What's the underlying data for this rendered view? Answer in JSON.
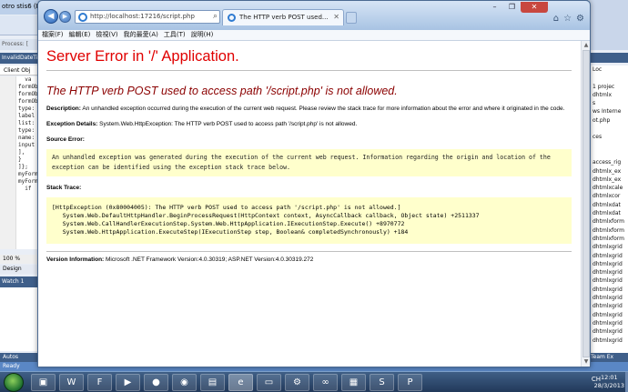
{
  "ide": {
    "title": "otro stis6 (Runni",
    "process_label": "Process: [",
    "tab_label": "InvalidDateTi",
    "client_label": "Client Obj",
    "code_lines": [
      "  va",
      "",
      "",
      "",
      "formOb",
      "formOb",
      "formOb",
      "type:",
      "label",
      "list:",
      "type:",
      "name:",
      "input",
      "",
      "",
      "",
      "",
      "],",
      "}",
      "]};",
      "",
      "myForm",
      "",
      "myForm",
      "  if"
    ],
    "zoom": "100 %",
    "design_tab": "Design",
    "watch_label": "Watch 1",
    "autos_label": "Autos",
    "status": "Ready",
    "right_items": [
      "Loc",
      "",
      "1 projec",
      "dhtmlx",
      "s",
      "ws Interne",
      "ot.php",
      "",
      "ces",
      "",
      "",
      "access_rig",
      "dhtmlx_ex",
      "dhtmlx_ex",
      "dhtmlxcale",
      "dhtmlxcor",
      "dhtmlxdat",
      "dhtmlxdat",
      "dhtmlxform",
      "dhtmlxform",
      "dhtmlxform",
      "dhtmlxgrid",
      "dhtmlxgrid",
      "dhtmlxgrid",
      "dhtmlxgrid",
      "dhtmlxgrid",
      "dhtmlxgrid",
      "dhtmlxgrid",
      "dhtmlxgrid",
      "dhtmlxgrid",
      "dhtmlxgrid",
      "dhtmlxgrid",
      "dhtmlxgrid"
    ],
    "right_bottom": "Team Ex"
  },
  "browser": {
    "url": "http://localhost:17216/script.php",
    "tab_title": "The HTTP verb POST used...",
    "menu": [
      "檔案(F)",
      "編輯(E)",
      "檢視(V)",
      "我的最愛(A)",
      "工具(T)",
      "說明(H)"
    ]
  },
  "page": {
    "title": "Server Error in '/' Application.",
    "subtitle": "The HTTP verb POST used to access path '/script.php' is not allowed.",
    "description_label": "Description:",
    "description_text": "An unhandled exception occurred during the execution of the current web request. Please review the stack trace for more information about the error and where it originated in the code.",
    "exception_label": "Exception Details:",
    "exception_text": "System.Web.HttpException: The HTTP verb POST used to access path '/script.php' is not allowed.",
    "source_error_label": "Source Error:",
    "source_error_text": "An unhandled exception was generated during the execution of the current web request. Information regarding the origin and location of the exception can be identified using the exception stack trace below.",
    "stack_trace_label": "Stack Trace:",
    "stack_lines": [
      "[HttpException (0x80004005): The HTTP verb POST used to access path '/script.php' is not allowed.]",
      "   System.Web.DefaultHttpHandler.BeginProcessRequest(HttpContext context, AsyncCallback callback, Object state) +2511337",
      "   System.Web.CallHandlerExecutionStep.System.Web.HttpApplication.IExecutionStep.Execute() +8970772",
      "   System.Web.HttpApplication.ExecuteStep(IExecutionStep step, Boolean& completedSynchronously) +184"
    ],
    "version_label": "Version Information:",
    "version_text": "Microsoft .NET Framework Version:4.0.30319; ASP.NET Version:4.0.30319.272"
  },
  "taskbar": {
    "tray_lang": "CH",
    "time": "12:01",
    "date": "28/3/2013"
  },
  "colors": {
    "error_title": "#e00000",
    "error_subtitle": "#8b0000",
    "yellow_box": "#ffffcc"
  }
}
